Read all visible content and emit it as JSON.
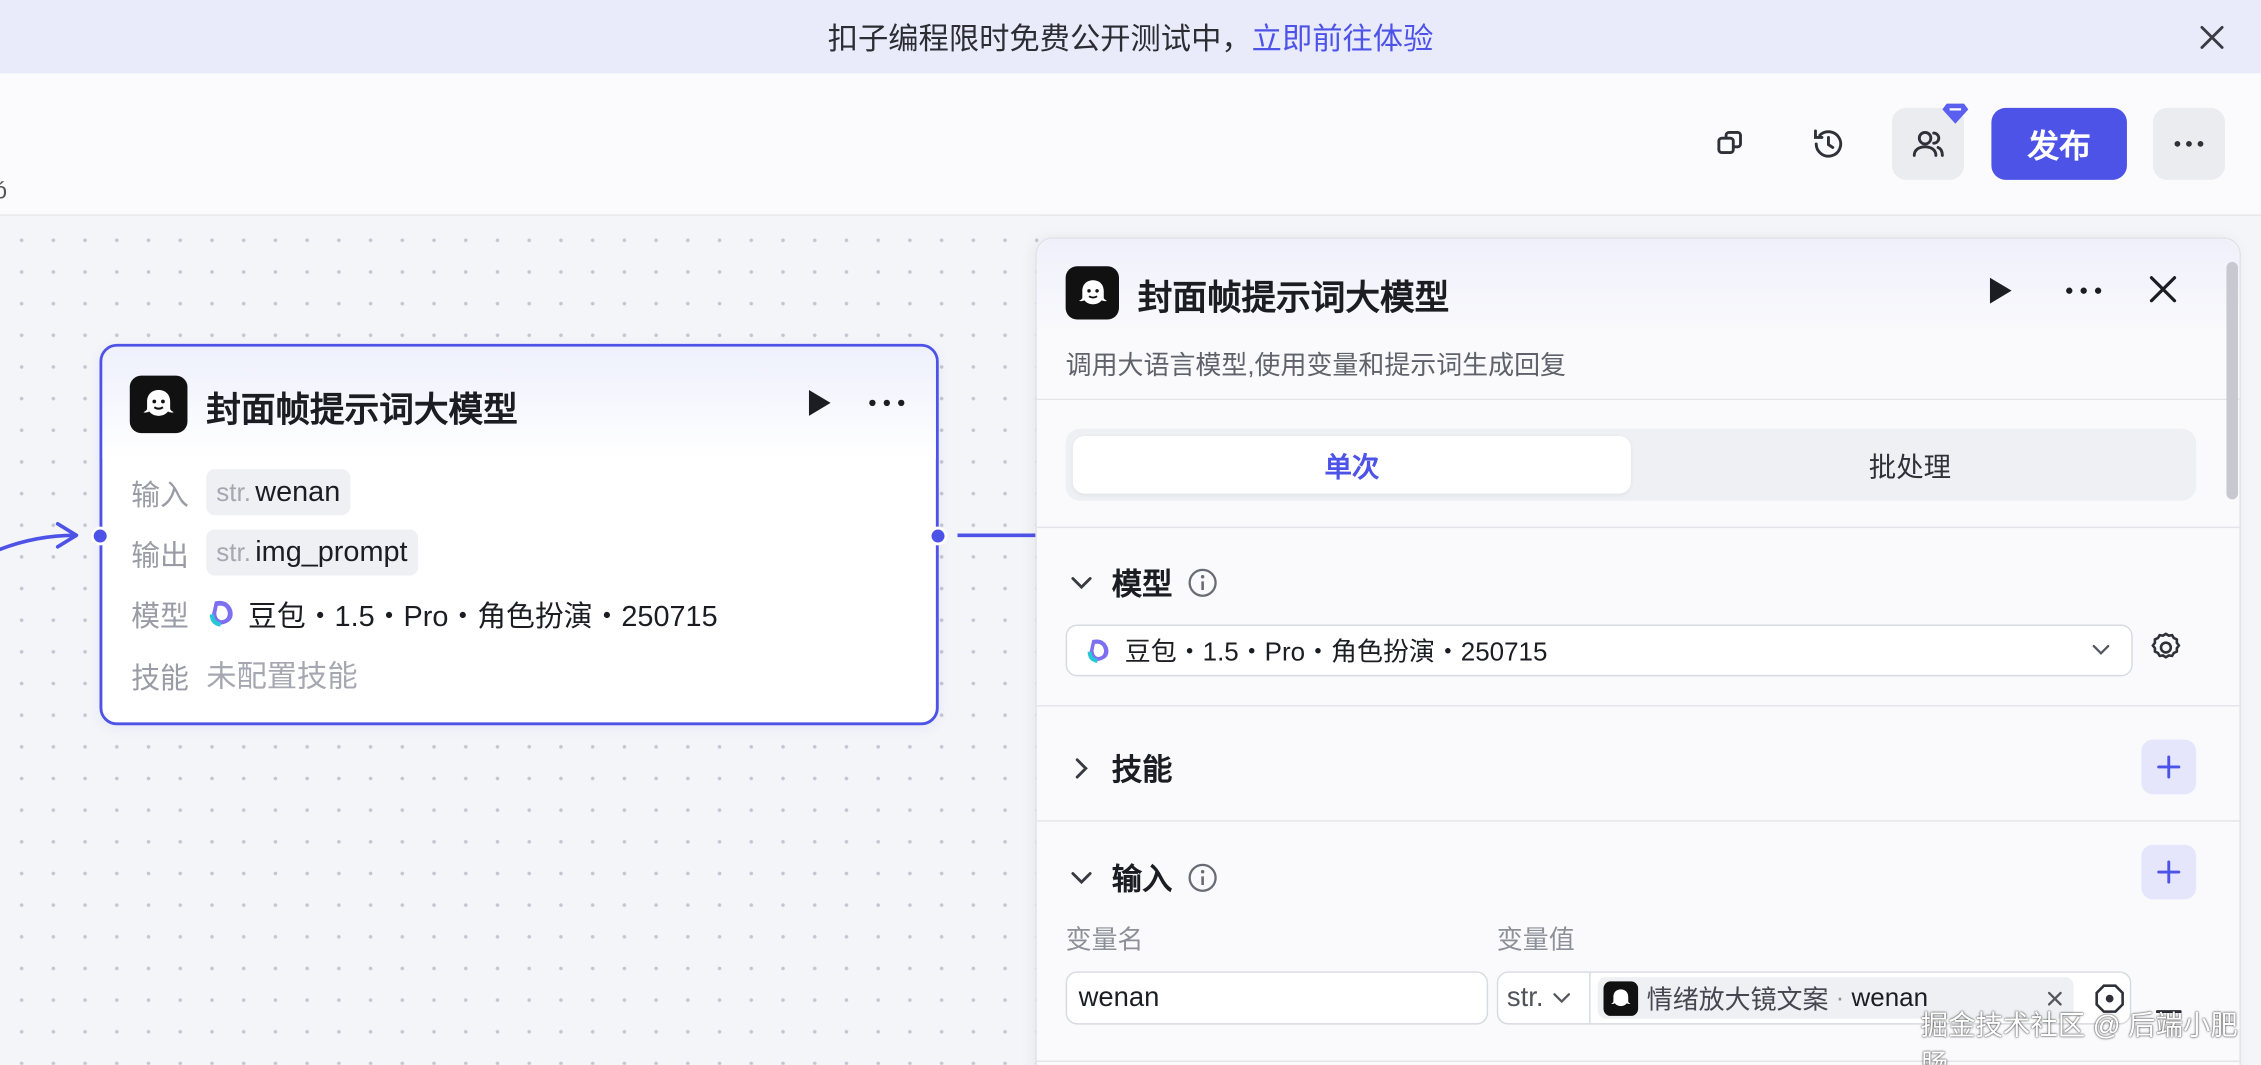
{
  "banner": {
    "text": "扣子编程限时免费公开测试中，",
    "link": "立即前往体验"
  },
  "header": {
    "publish_label": "发布"
  },
  "node": {
    "title": "封面帧提示词大模型",
    "rows": {
      "input_label": "输入",
      "input_type": "str.",
      "input_value": "wenan",
      "output_label": "输出",
      "output_type": "str.",
      "output_value": "img_prompt",
      "model_label": "模型",
      "model_value": "豆包・1.5・Pro・角色扮演・250715",
      "skill_label": "技能",
      "skill_value": "未配置技能"
    }
  },
  "panel": {
    "title": "封面帧提示词大模型",
    "description": "调用大语言模型,使用变量和提示词生成回复",
    "tabs": [
      "单次",
      "批处理"
    ],
    "active_tab": "单次",
    "sections": {
      "model": {
        "title": "模型",
        "selected": "豆包・1.5・Pro・角色扮演・250715"
      },
      "skills": {
        "title": "技能"
      },
      "input": {
        "title": "输入",
        "col_name": "变量名",
        "col_value": "变量值",
        "row": {
          "name": "wenan",
          "type": "str.",
          "ref_source": "情绪放大镜文案",
          "ref_separator": "·",
          "ref_var": "wenan"
        }
      }
    }
  },
  "watermark": "掘金技术社区 @ 后端小肥肠",
  "colors": {
    "accent": "#4e53e8",
    "banner_bg": "#e9ebfb",
    "canvas_bg": "#f4f5f8"
  }
}
